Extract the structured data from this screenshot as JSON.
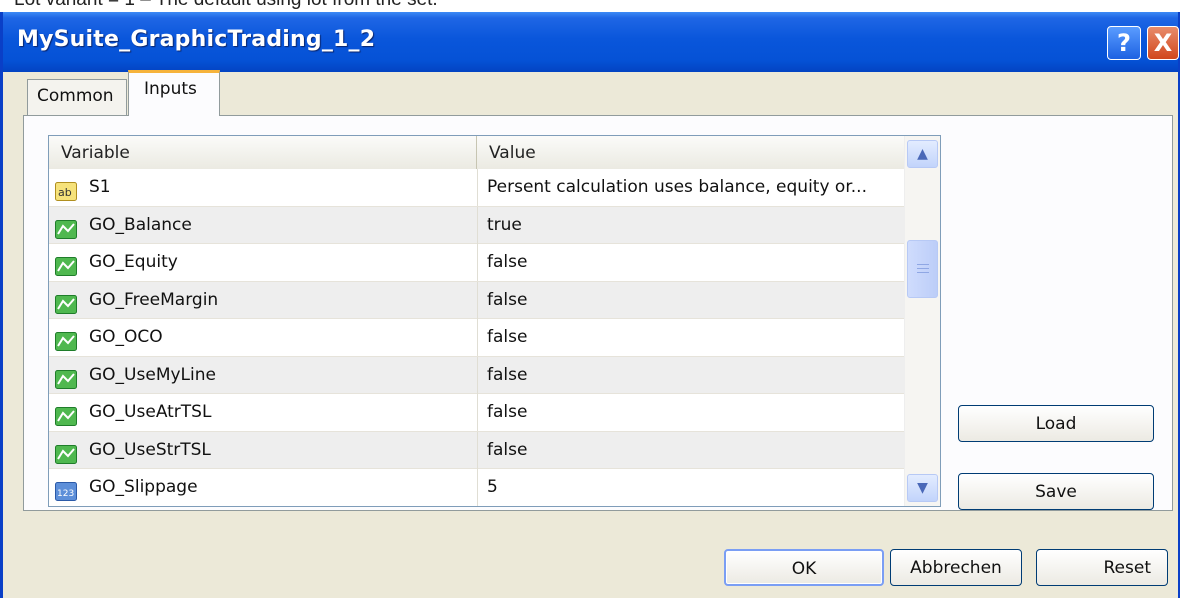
{
  "document_caption": "Lot variant = 1 – The default using lot from the set.",
  "window": {
    "title": "MySuite_GraphicTrading_1_2",
    "help_label": "?",
    "close_label": "X"
  },
  "tabs": [
    {
      "label": "Common"
    },
    {
      "label": "Inputs"
    }
  ],
  "grid": {
    "col_variable": "Variable",
    "col_value": "Value",
    "rows": [
      {
        "icon": "string-icon",
        "variable": "S1",
        "value": "Persent calculation uses balance, equity or..."
      },
      {
        "icon": "bool-icon",
        "variable": "GO_Balance",
        "value": "true"
      },
      {
        "icon": "bool-icon",
        "variable": "GO_Equity",
        "value": "false"
      },
      {
        "icon": "bool-icon",
        "variable": "GO_FreeMargin",
        "value": "false"
      },
      {
        "icon": "bool-icon",
        "variable": "GO_OCO",
        "value": "false"
      },
      {
        "icon": "bool-icon",
        "variable": "GO_UseMyLine",
        "value": "false"
      },
      {
        "icon": "bool-icon",
        "variable": "GO_UseAtrTSL",
        "value": "false"
      },
      {
        "icon": "bool-icon",
        "variable": "GO_UseStrTSL",
        "value": "false"
      },
      {
        "icon": "int-icon",
        "variable": "GO_Slippage",
        "value": "5"
      }
    ]
  },
  "buttons": {
    "load": "Load",
    "save": "Save",
    "ok": "OK",
    "cancel": "Abbrechen",
    "reset": "Reset"
  },
  "colors": {
    "titlebar": "#0552d6",
    "window_bg": "#ece9d8",
    "active_tab_accent": "#f6b33b"
  }
}
